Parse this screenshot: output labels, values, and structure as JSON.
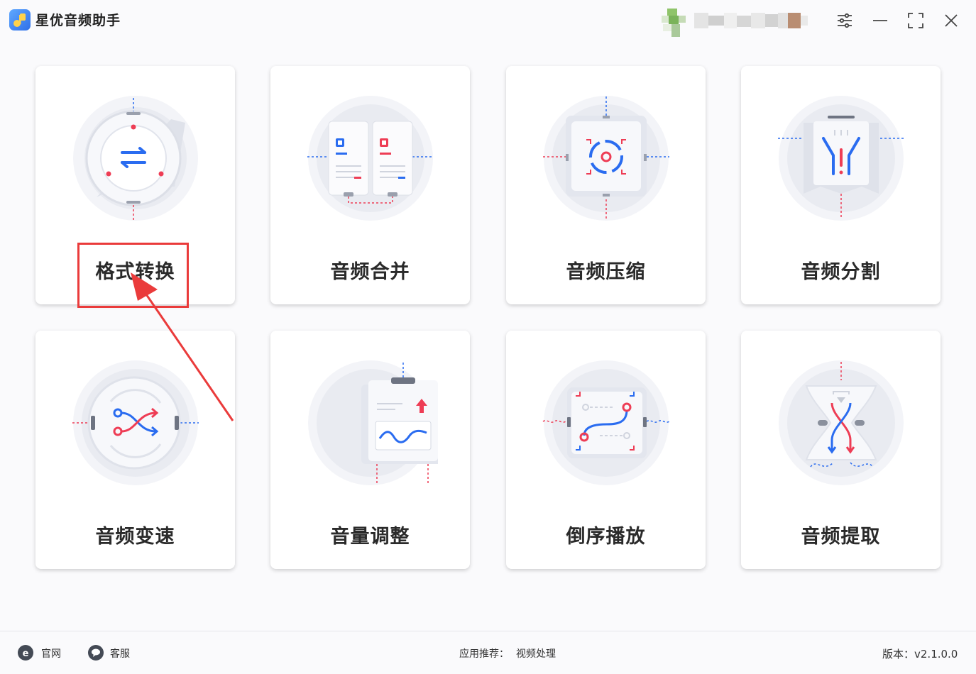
{
  "app": {
    "title": "星优音频助手"
  },
  "cards": [
    {
      "label": "格式转换",
      "icon": "format-convert-icon"
    },
    {
      "label": "音频合并",
      "icon": "audio-merge-icon"
    },
    {
      "label": "音频压缩",
      "icon": "audio-compress-icon"
    },
    {
      "label": "音频分割",
      "icon": "audio-split-icon"
    },
    {
      "label": "音频变速",
      "icon": "audio-speed-icon"
    },
    {
      "label": "音量调整",
      "icon": "volume-adjust-icon"
    },
    {
      "label": "倒序播放",
      "icon": "reverse-play-icon"
    },
    {
      "label": "音频提取",
      "icon": "audio-extract-icon"
    }
  ],
  "footer": {
    "website_label": "官网",
    "support_label": "客服",
    "recommend_label": "应用推荐：",
    "recommend_link": "视频处理",
    "version_label": "版本：v2.1.0.0"
  },
  "colors": {
    "accent_blue": "#2a6cf0",
    "accent_red": "#ee3d55",
    "annotation_red": "#ea3b3b"
  }
}
